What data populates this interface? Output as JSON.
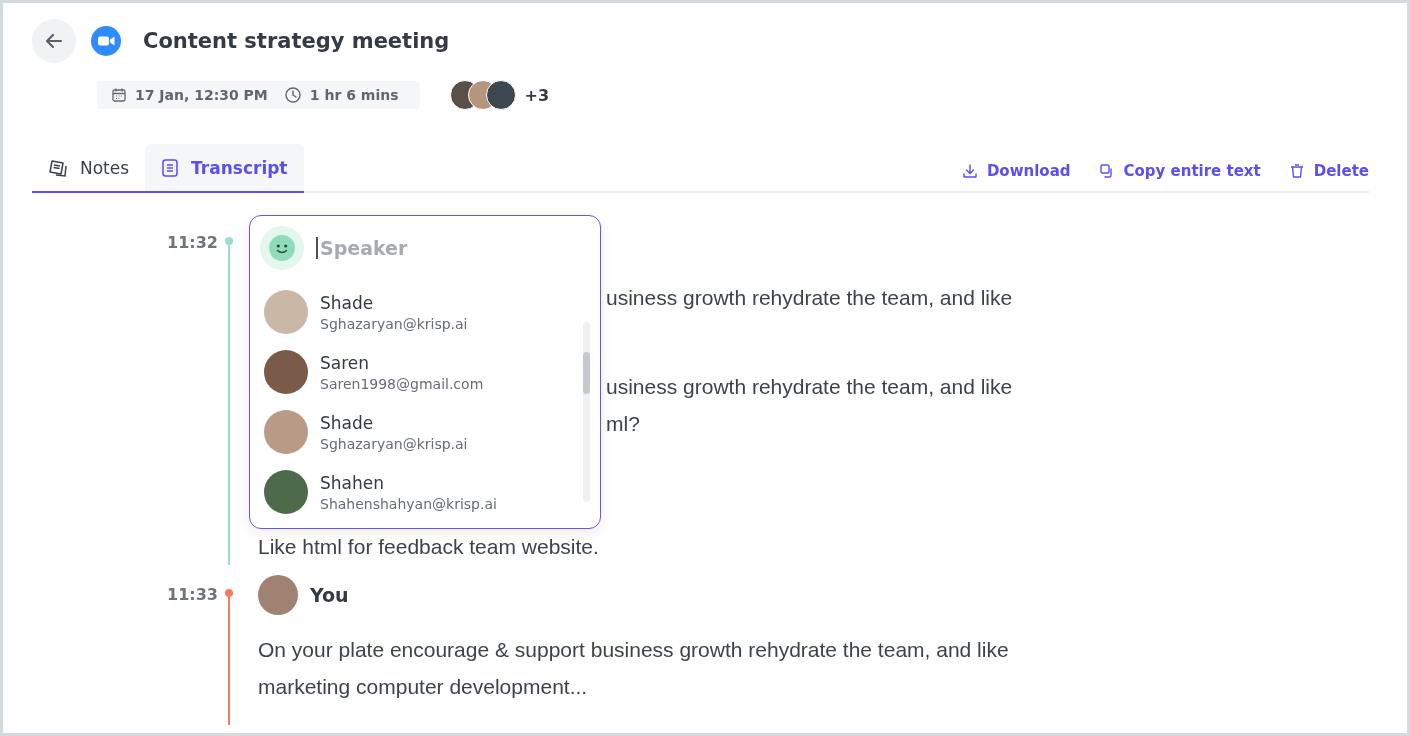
{
  "header": {
    "title": "Content strategy meeting",
    "date": "17 Jan, 12:30 PM",
    "duration": "1 hr 6 mins",
    "participants_extra": "+3"
  },
  "tabs": [
    {
      "label": "Notes",
      "selected": false,
      "kind": "notes"
    },
    {
      "label": "Transcript",
      "selected": true,
      "kind": "transcript"
    }
  ],
  "actions": [
    {
      "label": "Download",
      "kind": "download"
    },
    {
      "label": "Copy entire text",
      "kind": "copy"
    },
    {
      "label": "Delete",
      "kind": "delete"
    }
  ],
  "segments": [
    {
      "time": "11:32",
      "color": "#9adfc4",
      "lines": [
        {
          "text": "usiness growth rehydrate the team, and like",
          "kind": "covered"
        },
        {
          "text": "usiness growth rehydrate the team, and like",
          "kind": "covered"
        },
        {
          "text": "ml?",
          "kind": "covered"
        },
        {
          "text": "Like html for feedback team website.",
          "kind": "full"
        }
      ]
    },
    {
      "time": "11:33",
      "color": "#f87a63",
      "speaker": "You",
      "lines": [
        {
          "text": "On your plate encourage & support business growth rehydrate the team, and like",
          "kind": "full"
        },
        {
          "text": "marketing computer development...",
          "kind": "full"
        }
      ]
    }
  ],
  "speaker_picker": {
    "placeholder": "Speaker",
    "options": [
      {
        "name": "Shade",
        "email": "Sghazaryan@krisp.ai"
      },
      {
        "name": "Saren",
        "email": "Saren1998@gmail.com"
      },
      {
        "name": "Shade",
        "email": "Sghazaryan@krisp.ai"
      },
      {
        "name": "Shahen",
        "email": "Shahenshahyan@krisp.ai"
      }
    ]
  }
}
